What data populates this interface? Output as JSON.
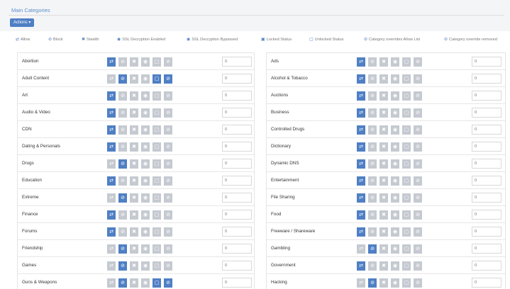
{
  "header": {
    "title": "Main Categories",
    "actions_label": "Actions ▾"
  },
  "legend": [
    {
      "glyph": "⇄",
      "label": "Allow",
      "icon": "allow-icon"
    },
    {
      "glyph": "⊘",
      "label": "Block",
      "icon": "block-icon"
    },
    {
      "glyph": "✖",
      "label": "Stealth",
      "icon": "stealth-icon"
    },
    {
      "glyph": "◉",
      "label": "SSL Decryption Enabled",
      "icon": "eye-icon"
    },
    {
      "glyph": "◉",
      "label": "SSL Decryption Bypassed",
      "icon": "eye-off-icon"
    },
    {
      "glyph": "▣",
      "label": "Locked Status",
      "icon": "lock-icon"
    },
    {
      "glyph": "▢",
      "label": "Unlocked Status",
      "icon": "unlock-icon"
    },
    {
      "glyph": "⊘",
      "label": "Category overrides Allow List",
      "icon": "override-icon"
    },
    {
      "glyph": "⊘",
      "label": "Category override removed",
      "icon": "override-removed-icon"
    }
  ],
  "button_icons": [
    "allow-icon",
    "block-icon",
    "stealth-icon",
    "eye-icon",
    "unlock-icon",
    "override-icon"
  ],
  "button_glyphs": [
    "⇄",
    "⊘",
    "✖",
    "◉",
    "▢",
    "⊘"
  ],
  "colors": {
    "active": "#4f7fc4",
    "inactive": "#c5cad1"
  },
  "left_categories": [
    {
      "name": "Abortion",
      "value": "0",
      "state": "allow"
    },
    {
      "name": "Adult Content",
      "value": "0",
      "state": "block-locked"
    },
    {
      "name": "Art",
      "value": "0",
      "state": "allow"
    },
    {
      "name": "Audio & Video",
      "value": "0",
      "state": "allow"
    },
    {
      "name": "CDN",
      "value": "0",
      "state": "allow"
    },
    {
      "name": "Dating & Personals",
      "value": "0",
      "state": "allow"
    },
    {
      "name": "Drugs",
      "value": "0",
      "state": "block"
    },
    {
      "name": "Education",
      "value": "0",
      "state": "allow"
    },
    {
      "name": "Extreme",
      "value": "0",
      "state": "block"
    },
    {
      "name": "Finance",
      "value": "0",
      "state": "allow"
    },
    {
      "name": "Forums",
      "value": "0",
      "state": "allow"
    },
    {
      "name": "Friendship",
      "value": "0",
      "state": "block"
    },
    {
      "name": "Games",
      "value": "0",
      "state": "block"
    },
    {
      "name": "Guns & Weapons",
      "value": "0",
      "state": "block-locked"
    }
  ],
  "right_categories": [
    {
      "name": "Ads",
      "value": "0",
      "state": "allow"
    },
    {
      "name": "Alcohol & Tobacco",
      "value": "0",
      "state": "allow"
    },
    {
      "name": "Auctions",
      "value": "0",
      "state": "allow"
    },
    {
      "name": "Business",
      "value": "0",
      "state": "allow"
    },
    {
      "name": "Controlled Drugs",
      "value": "0",
      "state": "allow"
    },
    {
      "name": "Dictionary",
      "value": "0",
      "state": "allow"
    },
    {
      "name": "Dynamic DNS",
      "value": "0",
      "state": "allow"
    },
    {
      "name": "Entertainment",
      "value": "0",
      "state": "allow"
    },
    {
      "name": "File Sharing",
      "value": "0",
      "state": "allow"
    },
    {
      "name": "Food",
      "value": "0",
      "state": "allow"
    },
    {
      "name": "Freeware / Shareware",
      "value": "0",
      "state": "allow"
    },
    {
      "name": "Gambling",
      "value": "0",
      "state": "block"
    },
    {
      "name": "Government",
      "value": "0",
      "state": "allow"
    },
    {
      "name": "Hacking",
      "value": "0",
      "state": "block"
    }
  ]
}
